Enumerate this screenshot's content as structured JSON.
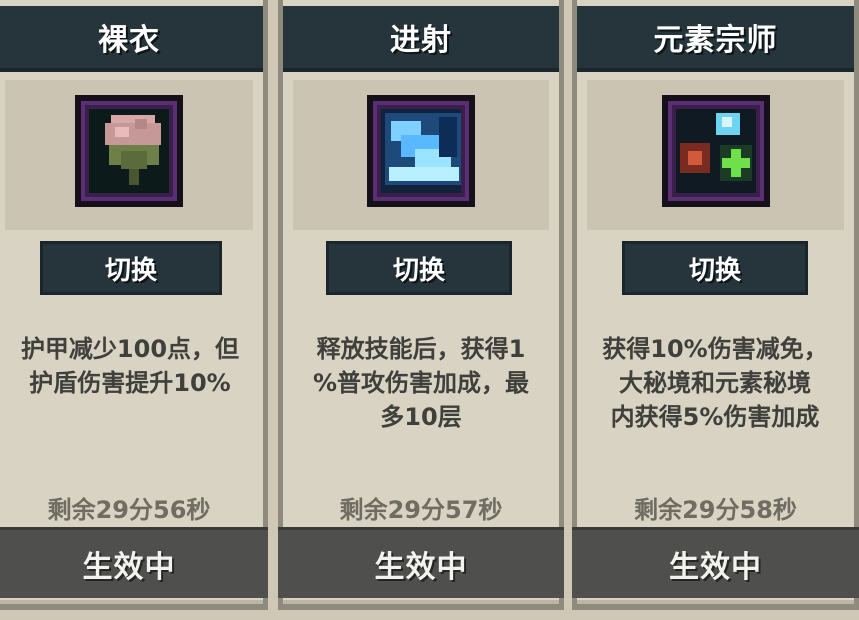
{
  "cards": [
    {
      "title": "裸衣",
      "icon": "pink-flower-icon",
      "switch_label": "切换",
      "description": "护甲减少100点，但\n护盾伤害提升10%",
      "timer": "剩余29分56秒",
      "status": "生效中"
    },
    {
      "title": "进射",
      "icon": "blue-ice-shard-icon",
      "switch_label": "切换",
      "description": "释放技能后，获得1\n%普攻伤害加成，最\n多10层",
      "timer": "剩余29分57秒",
      "status": "生效中"
    },
    {
      "title": "元素宗师",
      "icon": "element-orbs-icon",
      "switch_label": "切换",
      "description": "获得10%伤害减免，\n大秘境和元素秘境\n内获得5%伤害加成",
      "timer": "剩余29分58秒",
      "status": "生效中"
    }
  ],
  "colors": {
    "card_bg": "#d9d3c3",
    "header_bg": "#26353b",
    "status_bar_bg": "#4f4f4d",
    "icon_frame": "#5a2f74"
  }
}
